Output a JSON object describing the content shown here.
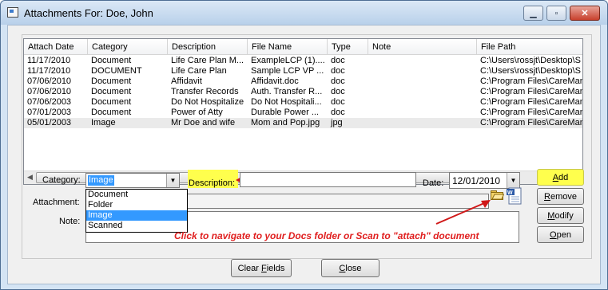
{
  "window": {
    "title": "Attachments For: Doe, John",
    "minimize_icon": "minimize-icon",
    "restore_icon": "restore-icon",
    "close_icon": "close-icon"
  },
  "table": {
    "columns": [
      "Attach Date",
      "Category",
      "Description",
      "File Name",
      "Type",
      "Note",
      "File Path"
    ],
    "rows": [
      [
        "11/17/2010",
        "Document",
        "Life Care Plan M...",
        "ExampleLCP (1)....",
        "doc",
        "",
        "C:\\Users\\rossjt\\Desktop\\S"
      ],
      [
        "11/17/2010",
        "DOCUMENT",
        "Life Care Plan",
        "Sample LCP VP ...",
        "doc",
        "",
        "C:\\Users\\rossjt\\Desktop\\S"
      ],
      [
        "07/06/2010",
        "Document",
        "Affidavit",
        "Affidavit.doc",
        "doc",
        "",
        "C:\\Program Files\\CareMan"
      ],
      [
        "07/06/2010",
        "Document",
        "Transfer Records",
        "Auth. Transfer R...",
        "doc",
        "",
        "C:\\Program Files\\CareMan"
      ],
      [
        "07/06/2003",
        "Document",
        "Do Not Hospitalize",
        "Do Not Hospitali...",
        "doc",
        "",
        "C:\\Program Files\\CareMan"
      ],
      [
        "07/01/2003",
        "Document",
        "Power of Atty",
        "Durable Power ...",
        "doc",
        "",
        "C:\\Program Files\\CareMan"
      ],
      [
        "05/01/2003",
        "Image",
        "Mr Doe and wife",
        "Mom and Pop.jpg",
        "jpg",
        "",
        "C:\\Program Files\\CareMan"
      ]
    ],
    "selected_row": 6
  },
  "form": {
    "category_label": "Category:",
    "category_value": "Image",
    "category_options": [
      "Document",
      "Folder",
      "Image",
      "Scanned"
    ],
    "description_label": "Description:",
    "description_value": "",
    "date_label": "Date:",
    "date_value": "12/01/2010",
    "attachment_label": "Attachment:",
    "note_label": "Note:"
  },
  "buttons": {
    "add": "Add",
    "remove": "Remove",
    "modify": "Modify",
    "open": "Open",
    "clear_fields": "Clear Fields",
    "close": "Close"
  },
  "annotation": "Click to navigate to your Docs folder or Scan to \"attach\" document",
  "colors": {
    "highlight": "#ffff4d",
    "selection": "#3399ff",
    "annotation": "#e02020"
  }
}
